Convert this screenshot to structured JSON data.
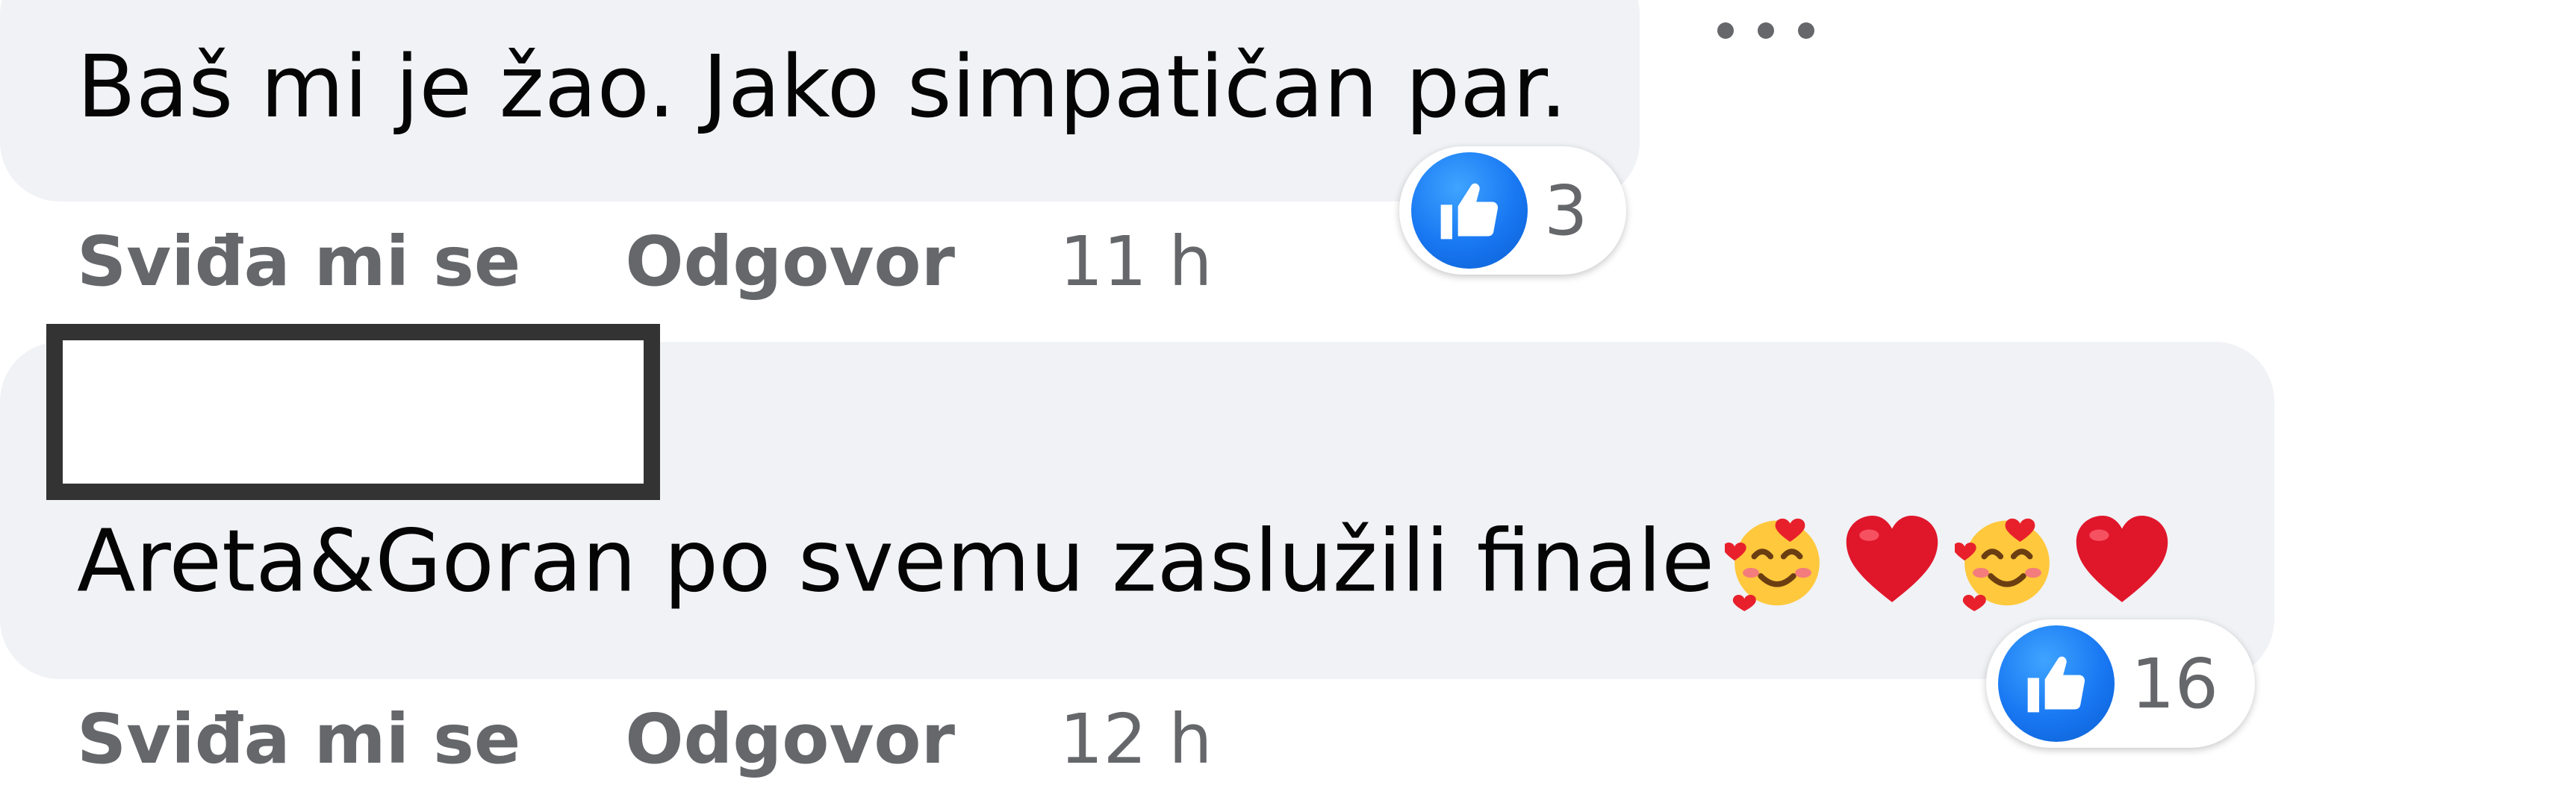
{
  "comments": [
    {
      "text": "Baš mi je žao. Jako simpatičan par.",
      "actions": {
        "like_label": "Sviđa mi se",
        "reply_label": "Odgovor",
        "timestamp": "11 h"
      },
      "reaction": {
        "icon": "thumbs-up-icon",
        "count": "3"
      }
    },
    {
      "text": "Areta&Goran po svemu zaslužili finale",
      "emojis": [
        "smiling-face-with-hearts-icon",
        "red-heart-icon",
        "smiling-face-with-hearts-icon",
        "red-heart-icon"
      ],
      "actions": {
        "like_label": "Sviđa mi se",
        "reply_label": "Odgovor",
        "timestamp": "12 h"
      },
      "reaction": {
        "icon": "thumbs-up-icon",
        "count": "16"
      }
    }
  ],
  "colors": {
    "bubble_bg": "#f0f2f5",
    "text": "#050505",
    "secondary_text": "#65676b",
    "like_blue": "#1877f2",
    "redaction_border": "#333333"
  }
}
